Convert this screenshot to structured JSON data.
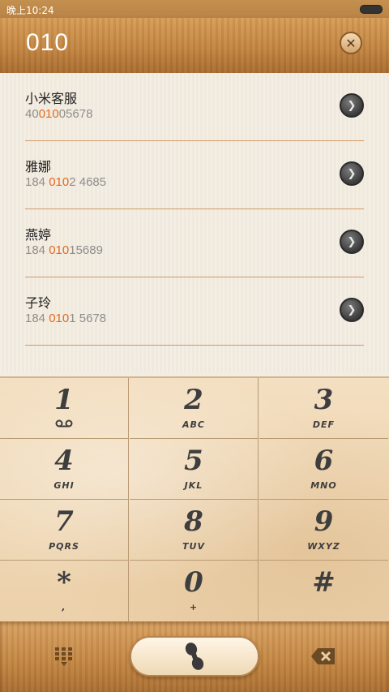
{
  "status_bar": {
    "time": "晚上10:24"
  },
  "header": {
    "query": "010"
  },
  "contacts": [
    {
      "name": "小米客服",
      "number_pre": "40",
      "number_hl": "010",
      "number_post": "05678"
    },
    {
      "name": "雅娜",
      "number_pre": "184 ",
      "number_hl": "010",
      "number_post": "2 4685"
    },
    {
      "name": "燕婷",
      "number_pre": "184 ",
      "number_hl": "010",
      "number_post": "15689"
    },
    {
      "name": "子玲",
      "number_pre": "184 ",
      "number_hl": "010",
      "number_post": "1 5678"
    }
  ],
  "keypad": [
    {
      "digit": "1",
      "letters": ""
    },
    {
      "digit": "2",
      "letters": "ABC"
    },
    {
      "digit": "3",
      "letters": "DEF"
    },
    {
      "digit": "4",
      "letters": "GHI"
    },
    {
      "digit": "5",
      "letters": "JKL"
    },
    {
      "digit": "6",
      "letters": "MNO"
    },
    {
      "digit": "7",
      "letters": "PQRS"
    },
    {
      "digit": "8",
      "letters": "TUV"
    },
    {
      "digit": "9",
      "letters": "WXYZ"
    },
    {
      "digit": "*",
      "letters": ","
    },
    {
      "digit": "0",
      "letters": "+"
    },
    {
      "digit": "#",
      "letters": ""
    }
  ],
  "icons": {
    "clear": "close-icon",
    "contact_arrow": "chevron-right-icon",
    "voicemail": "voicemail-icon",
    "keypad_toggle": "dialpad-icon",
    "call": "phone-icon",
    "delete": "backspace-icon"
  },
  "colors": {
    "highlight": "#e36a1f",
    "wood": "#c28442",
    "keypad_bg": "#f0d8b5"
  }
}
